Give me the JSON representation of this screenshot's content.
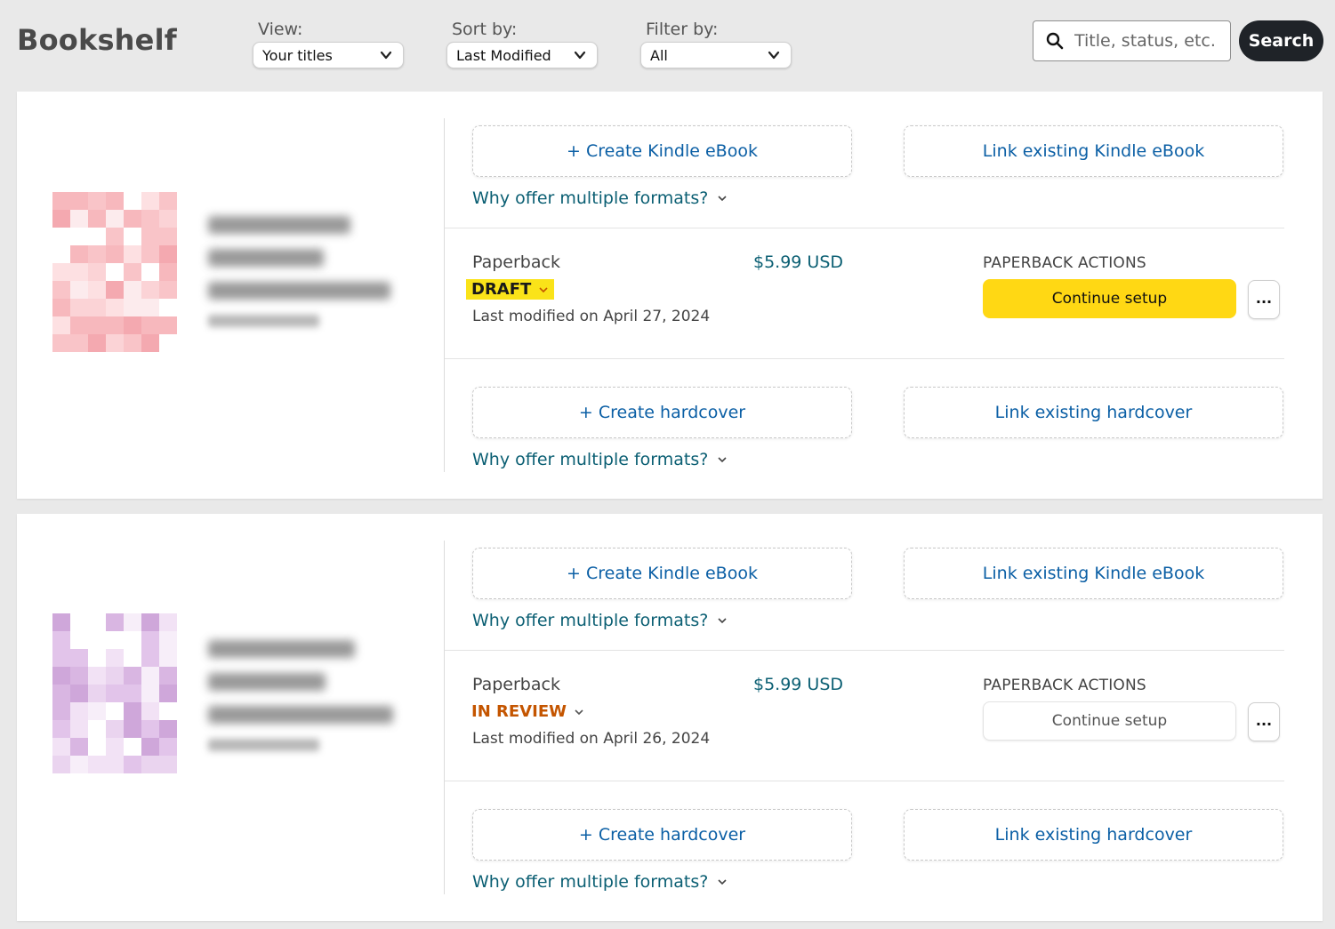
{
  "header": {
    "title": "Bookshelf",
    "view": {
      "label": "View:",
      "value": "Your titles"
    },
    "sort": {
      "label": "Sort by:",
      "value": "Last Modified"
    },
    "filter": {
      "label": "Filter by:",
      "value": "All"
    },
    "search": {
      "placeholder": "Title, status, etc.",
      "button_label": "Search"
    }
  },
  "books": [
    {
      "kindle": {
        "create_label": "+ Create Kindle eBook",
        "link_label": "Link existing Kindle eBook",
        "why_label": "Why offer multiple formats?"
      },
      "paperback": {
        "format": "Paperback",
        "status": "DRAFT",
        "modified": "Last modified on April 27, 2024",
        "price": "$5.99 USD",
        "actions_label": "PAPERBACK ACTIONS",
        "continue_label": "Continue setup",
        "more_label": "..."
      },
      "hardcover": {
        "create_label": "+ Create hardcover",
        "link_label": "Link existing hardcover",
        "why_label": "Why offer multiple formats?"
      }
    },
    {
      "kindle": {
        "create_label": "+ Create Kindle eBook",
        "link_label": "Link existing Kindle eBook",
        "why_label": "Why offer multiple formats?"
      },
      "paperback": {
        "format": "Paperback",
        "status": "IN REVIEW",
        "modified": "Last modified on April 26, 2024",
        "price": "$5.99 USD",
        "actions_label": "PAPERBACK ACTIONS",
        "continue_label": "Continue setup",
        "more_label": "..."
      },
      "hardcover": {
        "create_label": "+ Create hardcover",
        "link_label": "Link existing hardcover",
        "why_label": "Why offer multiple formats?"
      }
    }
  ],
  "colors": {
    "accent_link": "#0b5fa5",
    "draft_highlight": "#fae319",
    "review_status": "#c45500",
    "primary_button": "#ffd814",
    "search_button": "#1f2328"
  },
  "icons": {
    "search": "search-icon",
    "dropdown": "chevron-down-icon"
  }
}
